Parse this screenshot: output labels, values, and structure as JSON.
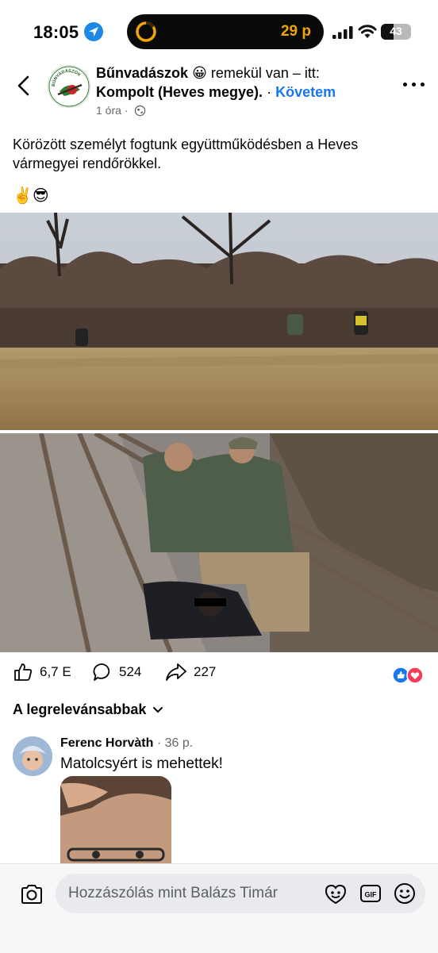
{
  "status_bar": {
    "time": "18:05",
    "timer": "29 p",
    "battery": "43",
    "battery_level": 0.43
  },
  "header": {
    "page_name": "Bűnvadászok",
    "feeling_emoji": "😀",
    "feeling_text": "remekül van – itt:",
    "location": "Kompolt (Heves megye).",
    "separator": "·",
    "follow_label": "Követem",
    "time_ago": "1 óra",
    "meta_separator": "·",
    "avatar_logo_text": "BŰNVADÁSZOK"
  },
  "post": {
    "text": "Körözött személyt fogtunk együttműködésben a Heves vármegyei rendőrökkel.",
    "emojis": "✌️😎"
  },
  "stats": {
    "likes": "6,7 E",
    "comments": "524",
    "shares": "227"
  },
  "sort": {
    "label": "A legrelevánsabbak"
  },
  "comment": {
    "author": "Ferenc Horvàth",
    "separator": "·",
    "time": "36 p.",
    "text": "Matolcsyért is mehettek!"
  },
  "composer": {
    "placeholder": "Hozzászólás mint Balázs Timár"
  },
  "colors": {
    "accent": "#1877f2",
    "like_blue": "#1877f2",
    "love_red": "#f33e58",
    "timer_orange": "#f0a500",
    "secondary_text": "#65676b"
  }
}
